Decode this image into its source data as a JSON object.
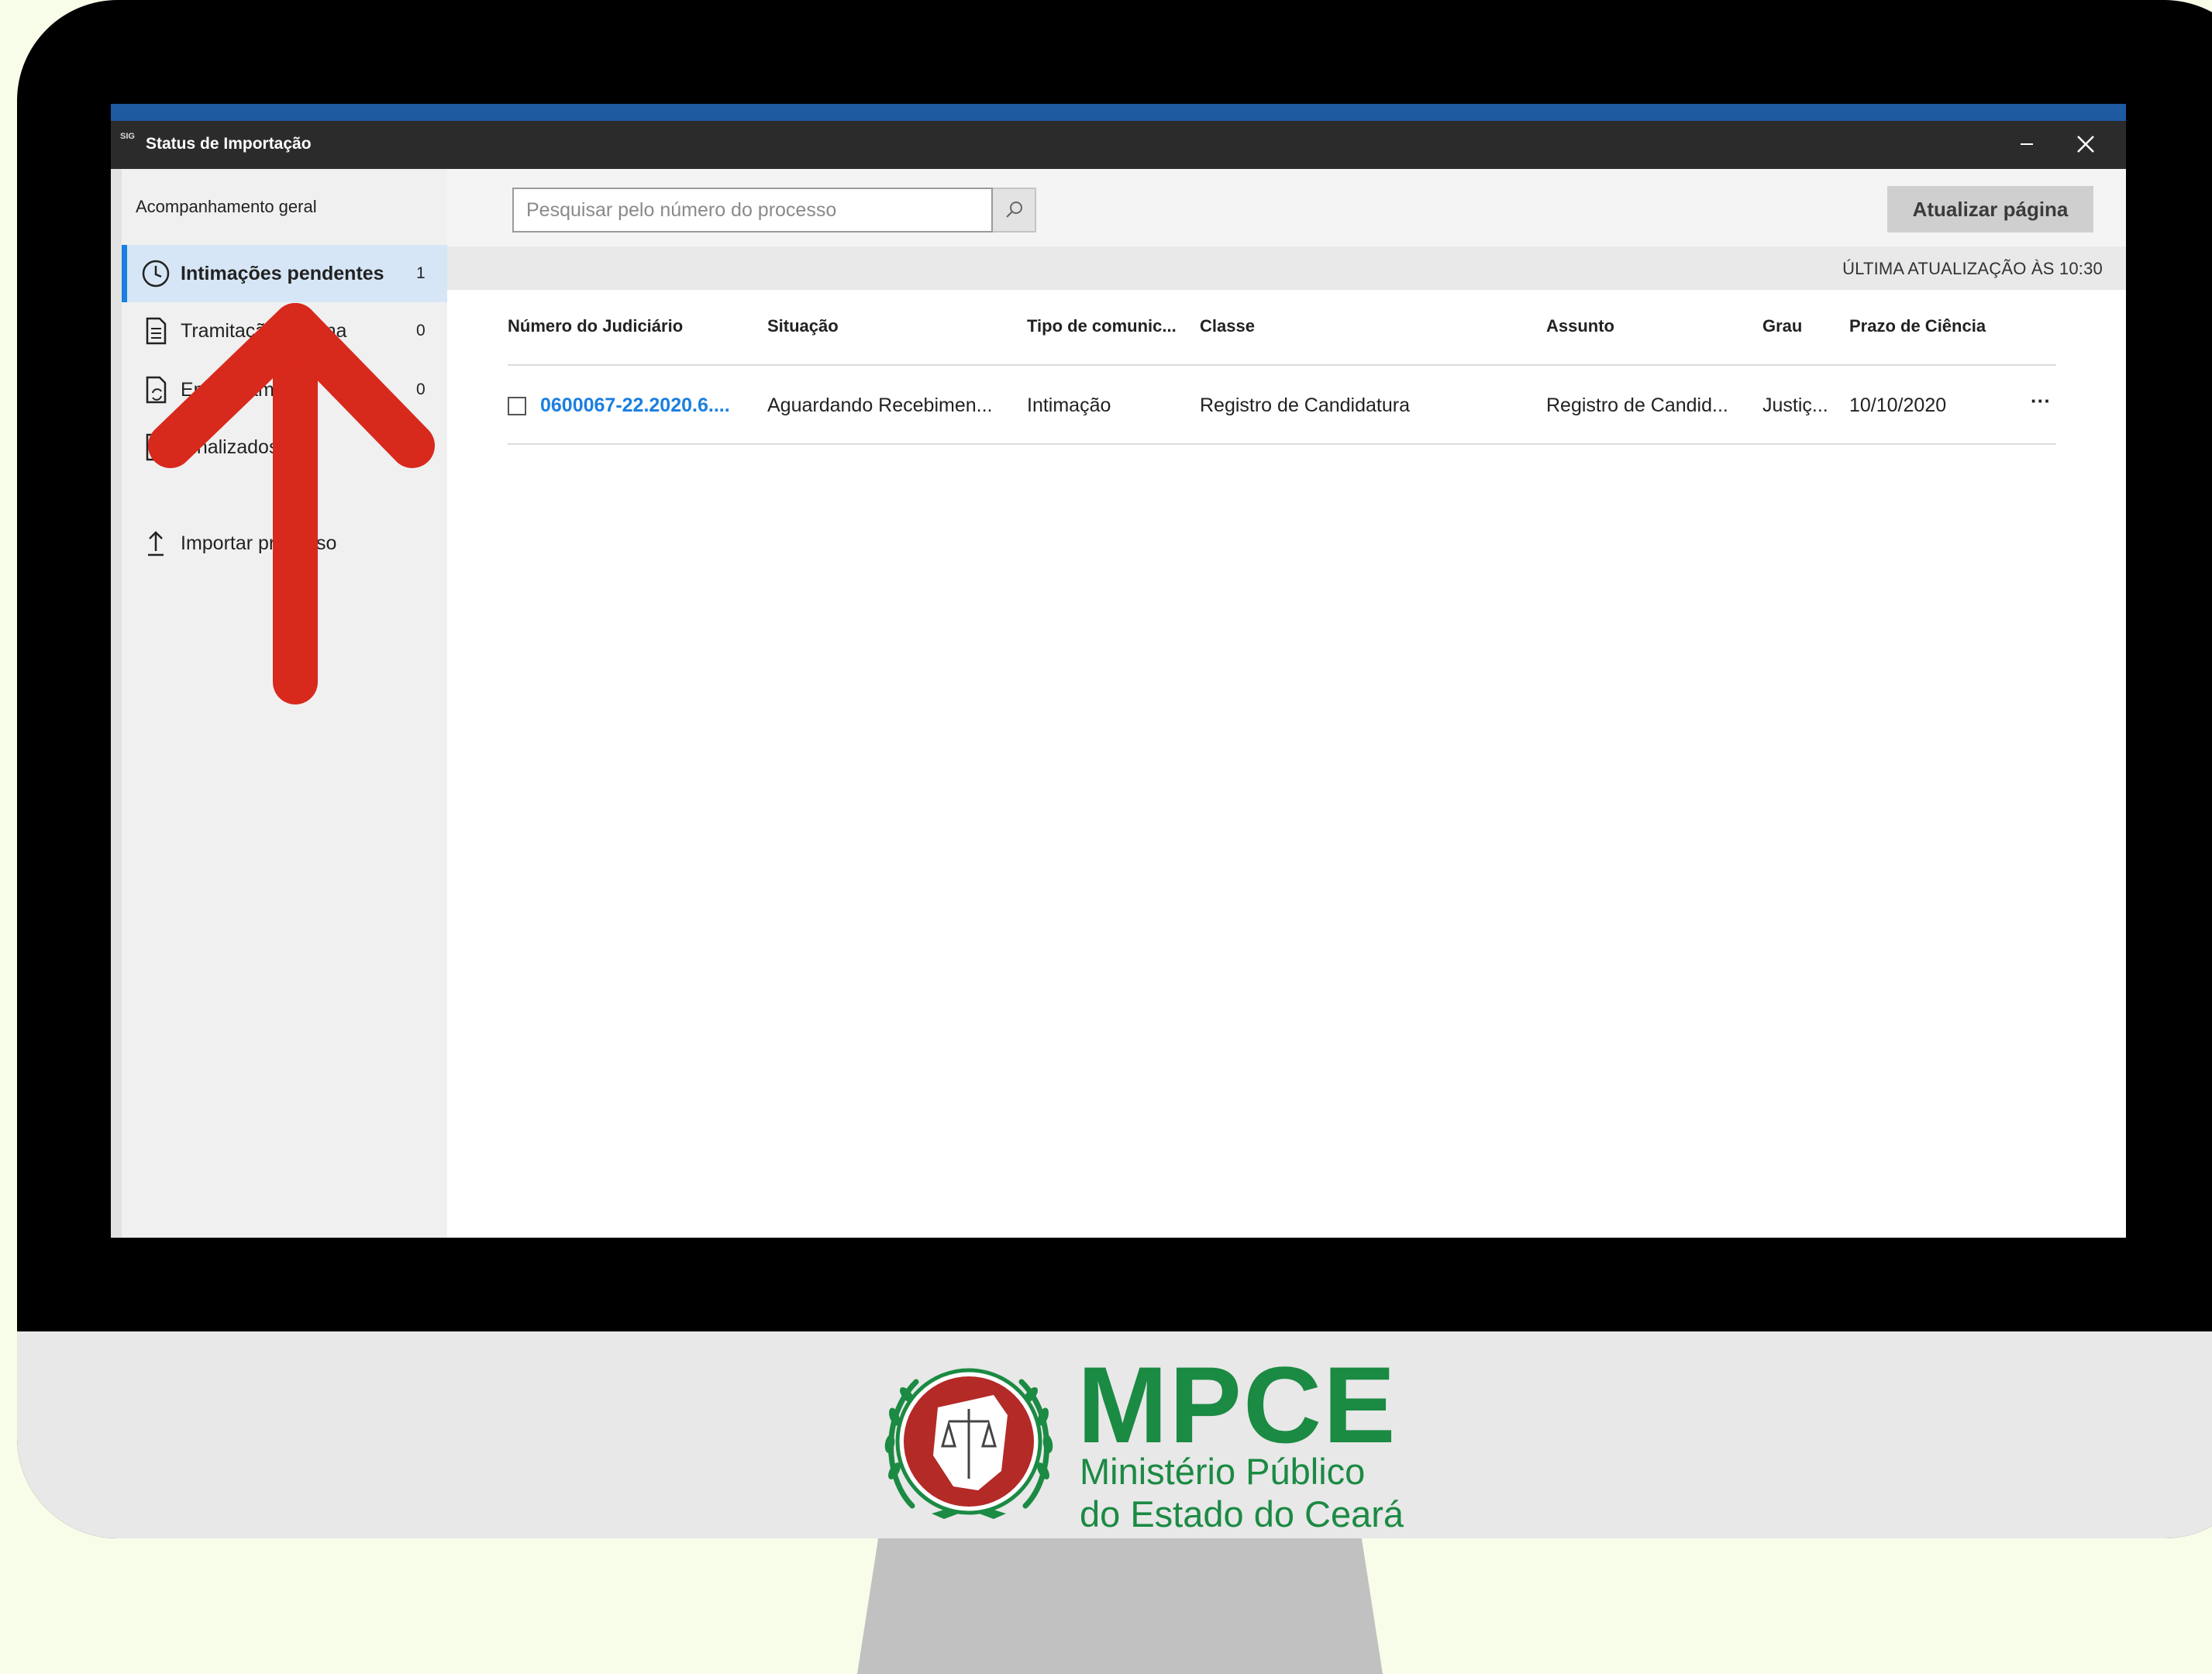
{
  "window": {
    "title": "Status de Importação",
    "app_icon_text": "SIG"
  },
  "sidebar": {
    "header": "Acompanhamento geral",
    "items": [
      {
        "label": "Intimações pendentes",
        "count": "1"
      },
      {
        "label": "Tramitação externa",
        "count": "0"
      },
      {
        "label": "Em andamento",
        "count": "0"
      },
      {
        "label": "Finalizados",
        "count": ""
      },
      {
        "label": "Importar processo",
        "count": ""
      }
    ]
  },
  "search": {
    "placeholder": "Pesquisar pelo número do processo",
    "value": ""
  },
  "toolbar": {
    "refresh_label": "Atualizar página"
  },
  "status": {
    "last_update": "ÚLTIMA ATUALIZAÇÃO ÀS 10:30"
  },
  "table": {
    "columns": [
      "Número do Judiciário",
      "Situação",
      "Tipo de comunic...",
      "Classe",
      "Assunto",
      "Grau",
      "Prazo de Ciência"
    ],
    "rows": [
      {
        "numero": "0600067-22.2020.6....",
        "situacao": "Aguardando Recebimen...",
        "tipo": "Intimação",
        "classe": "Registro de Candidatura",
        "assunto": "Registro de Candid...",
        "grau": "Justiç...",
        "prazo": "10/10/2020",
        "more": "···"
      }
    ]
  },
  "logo": {
    "abbr": "MPCE",
    "line1": "Ministério Público",
    "line2": "do Estado do Ceará"
  },
  "colors": {
    "accent": "#1a7fe0",
    "arrow": "#d8291d",
    "logo_green": "#1b8a43",
    "logo_red": "#b32a27",
    "background": "#f8fde9"
  }
}
